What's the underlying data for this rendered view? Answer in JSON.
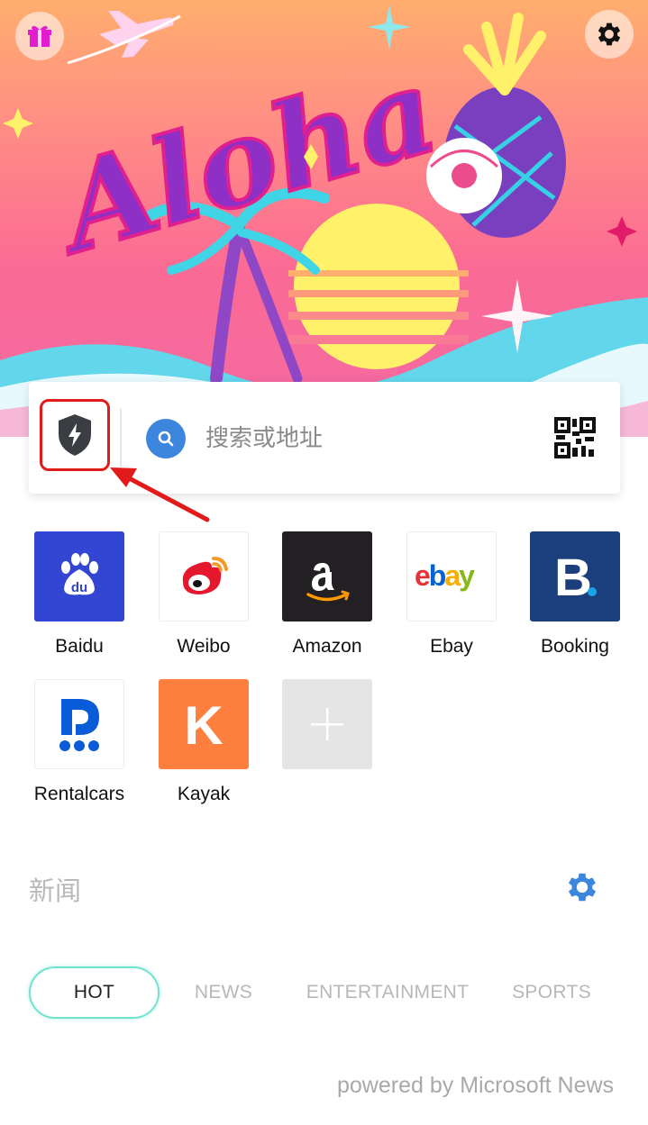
{
  "hero": {
    "banner_text": "Aloha",
    "gift_icon": "gift-icon",
    "settings_icon": "gear-icon"
  },
  "search": {
    "placeholder": "搜索或地址",
    "security_icon": "shield-bolt-icon",
    "search_icon": "search-icon",
    "scan_icon": "qr-code-icon"
  },
  "shortcuts": [
    {
      "label": "Baidu",
      "icon": "baidu-paw-icon",
      "color": "#3245d3"
    },
    {
      "label": "Weibo",
      "icon": "weibo-eye-icon",
      "color": "#e6162d"
    },
    {
      "label": "Amazon",
      "icon": "amazon-a-icon",
      "color": "#232023"
    },
    {
      "label": "Ebay",
      "icon": "ebay-logo-icon",
      "color": "#ffffff"
    },
    {
      "label": "Booking",
      "icon": "booking-b-icon",
      "color": "#1b3f7c"
    },
    {
      "label": "Rentalcars",
      "icon": "rentalcars-icon",
      "color": "#0a5bd8"
    },
    {
      "label": "Kayak",
      "icon": "kayak-k-icon",
      "color": "#ff7f3f"
    },
    {
      "label": "",
      "icon": "add-shortcut-icon",
      "color": "#e5e5e5"
    }
  ],
  "shortcut_glyphs": {
    "ebay": [
      "e",
      "b",
      "a",
      "y"
    ],
    "booking": "B",
    "kayak": "K",
    "baidu": "du"
  },
  "news": {
    "title": "新闻",
    "tabs": [
      {
        "label": "HOT",
        "active": true
      },
      {
        "label": "NEWS",
        "active": false
      },
      {
        "label": "ENTERTAINMENT",
        "active": false
      },
      {
        "label": "SPORTS",
        "active": false
      }
    ],
    "powered_by": "powered by Microsoft News"
  },
  "colors": {
    "accent_blue": "#3d86dd",
    "tab_active_border": "#6fe3cf",
    "highlight_red": "#e11a1a",
    "gift_magenta": "#e31dcf"
  }
}
